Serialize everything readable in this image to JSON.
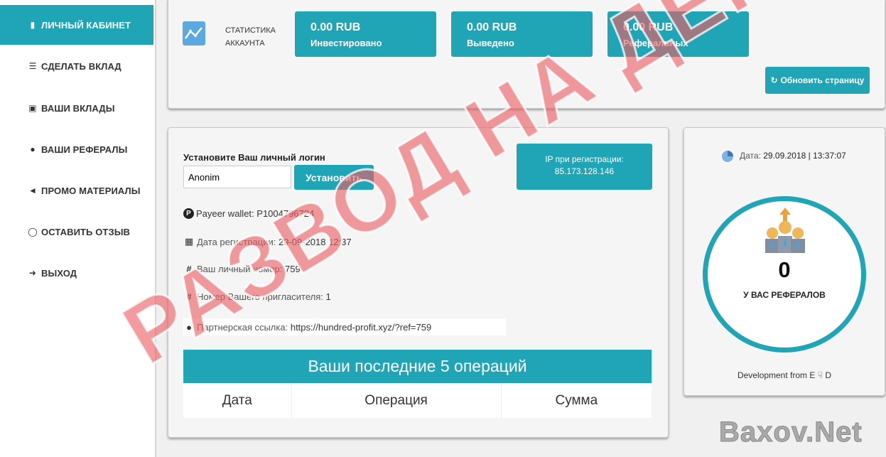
{
  "sidebar": {
    "items": [
      {
        "label": "ЛИЧНЫЙ КАБИНЕТ",
        "icon": "user-icon",
        "active": true
      },
      {
        "label": "СДЕЛАТЬ ВКЛАД",
        "icon": "database-icon"
      },
      {
        "label": "ВАШИ ВКЛАДЫ",
        "icon": "briefcase-icon"
      },
      {
        "label": "ВАШИ РЕФЕРАЛЫ",
        "icon": "users-icon"
      },
      {
        "label": "ПРОМО МАТЕРИАЛЫ",
        "icon": "megaphone-icon"
      },
      {
        "label": "ОСТАВИТЬ ОТЗЫВ",
        "icon": "comment-icon"
      },
      {
        "label": "ВЫХОД",
        "icon": "sign-out-icon"
      }
    ]
  },
  "stats": {
    "title_line1": "СТАТИСТИКА",
    "title_line2": "АККАУНТА",
    "cards": [
      {
        "amount": "0.00 RUB",
        "label": "Инвестировано"
      },
      {
        "amount": "0.00 RUB",
        "label": "Выведено"
      },
      {
        "amount": "0.00 RUB",
        "label": "Реферальных"
      }
    ],
    "refresh_label": "Обновить страницу"
  },
  "profile": {
    "login_title": "Установите Ваш личный логин",
    "login_value": "Anonim",
    "set_button": "Установить",
    "ip_label": "IP при регистрации:",
    "ip_value": "85.173.128.146",
    "wallet_label": "Payeer wallet:",
    "wallet_value": "P1004796724",
    "regdate_label": "Дата регистрации:",
    "regdate_value": "29-09-2018 12:37",
    "number_label": "Ваш личный номер:",
    "number_value": "759",
    "inviter_label": "Номер Вашего пригласителя:",
    "inviter_value": "1",
    "ref_label": "Партнерская ссылка:",
    "ref_value": "https://hundred-profit.xyz/?ref=759"
  },
  "operations": {
    "title": "Ваши последние 5 операций",
    "columns": [
      "Дата",
      "Операция",
      "Сумма"
    ]
  },
  "right": {
    "date_label": "Дата:",
    "date_value": "29.09.2018 | 13:37:07",
    "referrals_count": "0",
    "referrals_label": "У ВАС РЕФЕРАЛОВ",
    "dev_credit": "Development from E",
    "dev_credit_end": "D"
  },
  "overlay_text": "РАЗВОД НА ДЕНЬГИ",
  "watermark": "Baxov.Net",
  "colors": {
    "accent": "#1fa5b5",
    "overlay": "#eb5f64"
  }
}
